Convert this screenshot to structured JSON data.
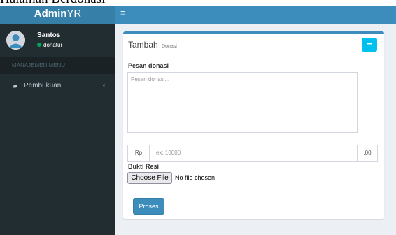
{
  "page": {
    "heading": "Halaman Berdonasi"
  },
  "header": {
    "logo_bold": "Admin",
    "logo_rest": "YR",
    "toggle_icon": "≡"
  },
  "sidebar": {
    "user": {
      "name": "Santos",
      "status": "donatur"
    },
    "menu_header": "MANAJEMEN MENU",
    "items": [
      {
        "label": "Pembukuan",
        "icon": "book-icon"
      }
    ]
  },
  "form": {
    "title": "Tambah",
    "subtitle": "Donasi",
    "collapse_label": "−",
    "pesan_label": "Pesan donasi",
    "pesan_placeholder": "Pesan donasi...",
    "currency_prefix": "Rp",
    "amount_placeholder": "ex: 10000",
    "currency_suffix": ".00",
    "resi_label": "Bukti Resi",
    "file_button": "Choose File",
    "file_status": "No file chosen",
    "submit_label": "Proses"
  },
  "colors": {
    "accent": "#3c8dbc",
    "logo_bg": "#367fa9",
    "sidebar_bg": "#222d32",
    "info": "#00c0ef",
    "online": "#00a65a"
  }
}
